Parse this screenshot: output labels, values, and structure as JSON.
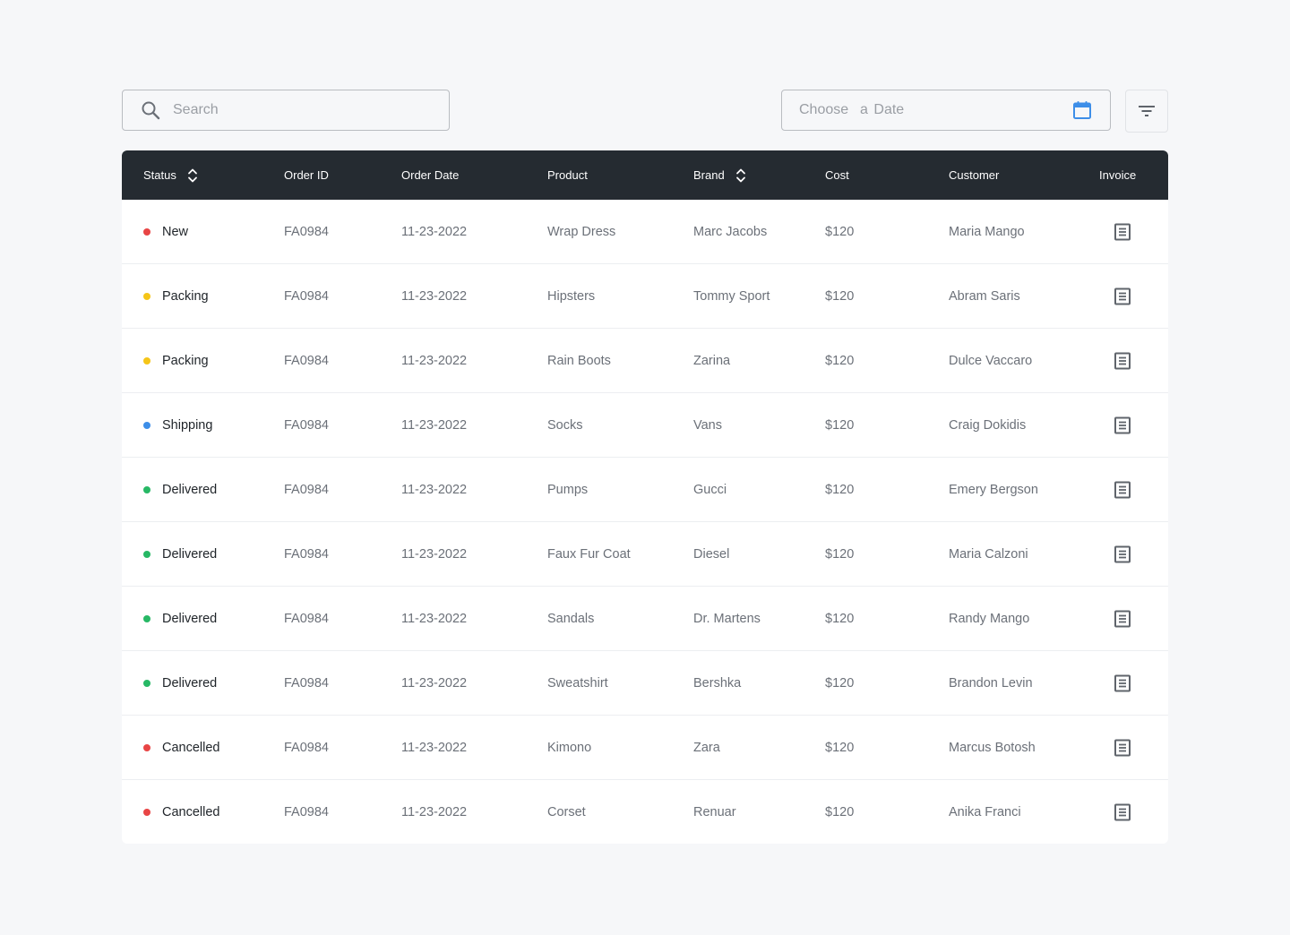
{
  "search": {
    "placeholder": "Search"
  },
  "date_filter": {
    "placeholder": "Choose  a Date"
  },
  "colors": {
    "new": "#e84545",
    "packing": "#f5c518",
    "shipping": "#3d8ee8",
    "delivered": "#27b865",
    "cancelled": "#e84545",
    "calendar_accent": "#3d8ee8",
    "header_bg": "#252b31"
  },
  "table": {
    "headers": {
      "status": "Status",
      "order_id": "Order ID",
      "order_date": "Order Date",
      "product": "Product",
      "brand": "Brand",
      "cost": "Cost",
      "customer": "Customer",
      "invoice": "Invoice"
    },
    "rows": [
      {
        "status": "New",
        "status_color": "#e84545",
        "order_id": "FA0984",
        "order_date": "11-23-2022",
        "product": "Wrap Dress",
        "brand": "Marc Jacobs",
        "cost": "$120",
        "customer": "Maria Mango"
      },
      {
        "status": "Packing",
        "status_color": "#f5c518",
        "order_id": "FA0984",
        "order_date": "11-23-2022",
        "product": "Hipsters",
        "brand": "Tommy Sport",
        "cost": "$120",
        "customer": "Abram Saris"
      },
      {
        "status": "Packing",
        "status_color": "#f5c518",
        "order_id": "FA0984",
        "order_date": "11-23-2022",
        "product": "Rain Boots",
        "brand": "Zarina",
        "cost": "$120",
        "customer": "Dulce Vaccaro"
      },
      {
        "status": "Shipping",
        "status_color": "#3d8ee8",
        "order_id": "FA0984",
        "order_date": "11-23-2022",
        "product": "Socks",
        "brand": "Vans",
        "cost": "$120",
        "customer": "Craig Dokidis"
      },
      {
        "status": "Delivered",
        "status_color": "#27b865",
        "order_id": "FA0984",
        "order_date": "11-23-2022",
        "product": "Pumps",
        "brand": "Gucci",
        "cost": "$120",
        "customer": "Emery Bergson"
      },
      {
        "status": "Delivered",
        "status_color": "#27b865",
        "order_id": "FA0984",
        "order_date": "11-23-2022",
        "product": "Faux Fur Coat",
        "brand": "Diesel",
        "cost": "$120",
        "customer": "Maria Calzoni"
      },
      {
        "status": "Delivered",
        "status_color": "#27b865",
        "order_id": "FA0984",
        "order_date": "11-23-2022",
        "product": "Sandals",
        "brand": "Dr. Martens",
        "cost": "$120",
        "customer": "Randy Mango"
      },
      {
        "status": "Delivered",
        "status_color": "#27b865",
        "order_id": "FA0984",
        "order_date": "11-23-2022",
        "product": "Sweatshirt",
        "brand": "Bershka",
        "cost": "$120",
        "customer": "Brandon Levin"
      },
      {
        "status": "Cancelled",
        "status_color": "#e84545",
        "order_id": "FA0984",
        "order_date": "11-23-2022",
        "product": "Kimono",
        "brand": "Zara",
        "cost": "$120",
        "customer": "Marcus Botosh"
      },
      {
        "status": "Cancelled",
        "status_color": "#e84545",
        "order_id": "FA0984",
        "order_date": "11-23-2022",
        "product": "Corset",
        "brand": "Renuar",
        "cost": "$120",
        "customer": "Anika Franci"
      }
    ]
  }
}
